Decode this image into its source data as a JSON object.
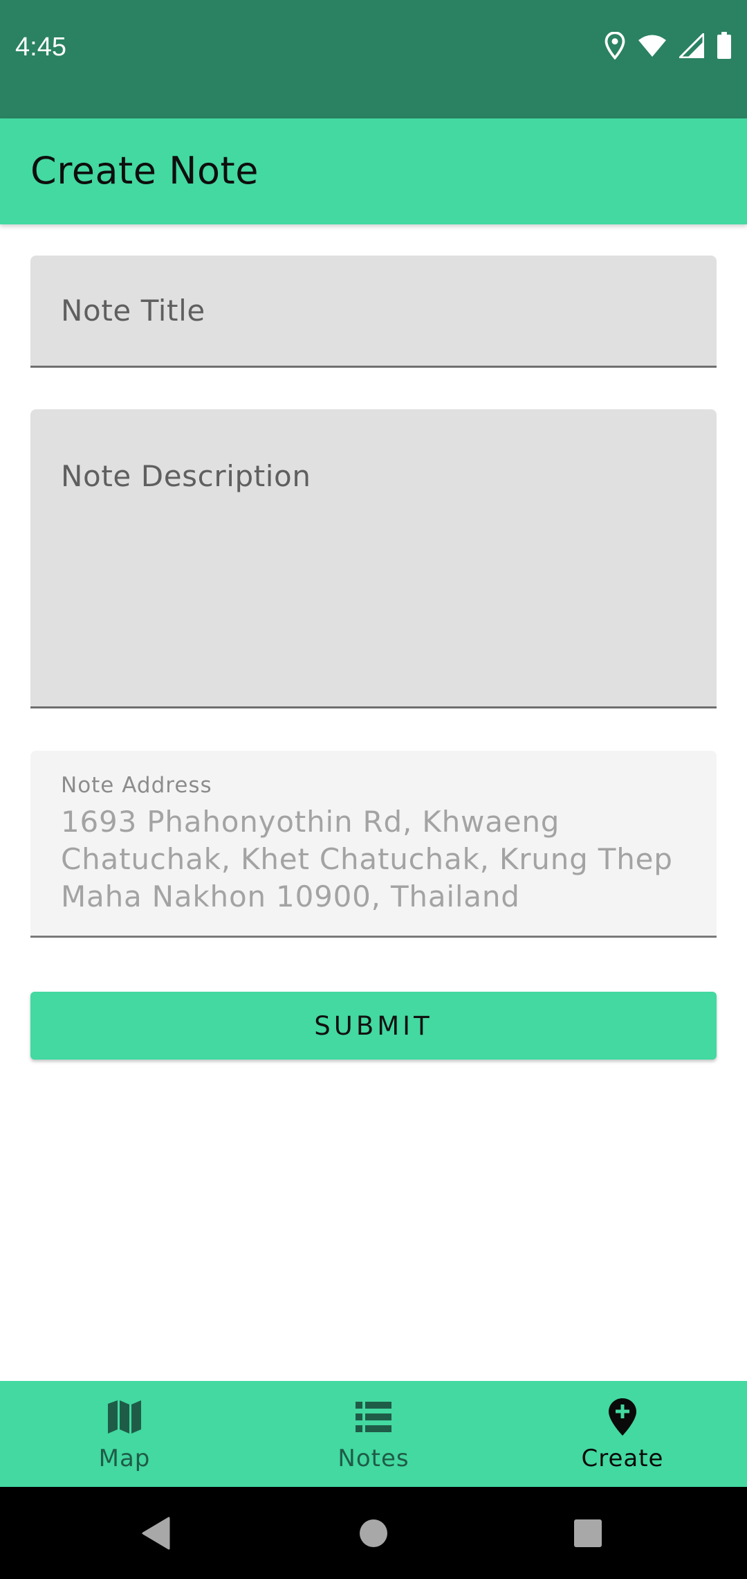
{
  "status_bar": {
    "time": "4:45",
    "icons": [
      "location-icon",
      "wifi-icon",
      "signal-icon",
      "battery-icon"
    ]
  },
  "app_bar": {
    "title": "Create Note"
  },
  "form": {
    "title_placeholder": "Note Title",
    "description_placeholder": "Note Description",
    "address_label": "Note Address",
    "address_value": "1693 Phahonyothin Rd, Khwaeng Chatuchak, Khet Chatuchak, Krung Thep Maha Nakhon 10900, Thailand",
    "submit_label": "SUBMIT"
  },
  "bottom_nav": {
    "items": [
      {
        "label": "Map",
        "icon": "map-icon",
        "active": false
      },
      {
        "label": "Notes",
        "icon": "list-icon",
        "active": false
      },
      {
        "label": "Create",
        "icon": "add-location-icon",
        "active": true
      }
    ]
  },
  "system_nav": {
    "buttons": [
      "back-icon",
      "home-icon",
      "recents-icon"
    ]
  },
  "colors": {
    "status_bar": "#2a8262",
    "primary": "#43d9a1",
    "field_bg": "#e0e0e0",
    "disabled_field_bg": "#f4f4f4",
    "nav_inactive": "#1f5c48",
    "nav_active": "#0a0a0a"
  }
}
